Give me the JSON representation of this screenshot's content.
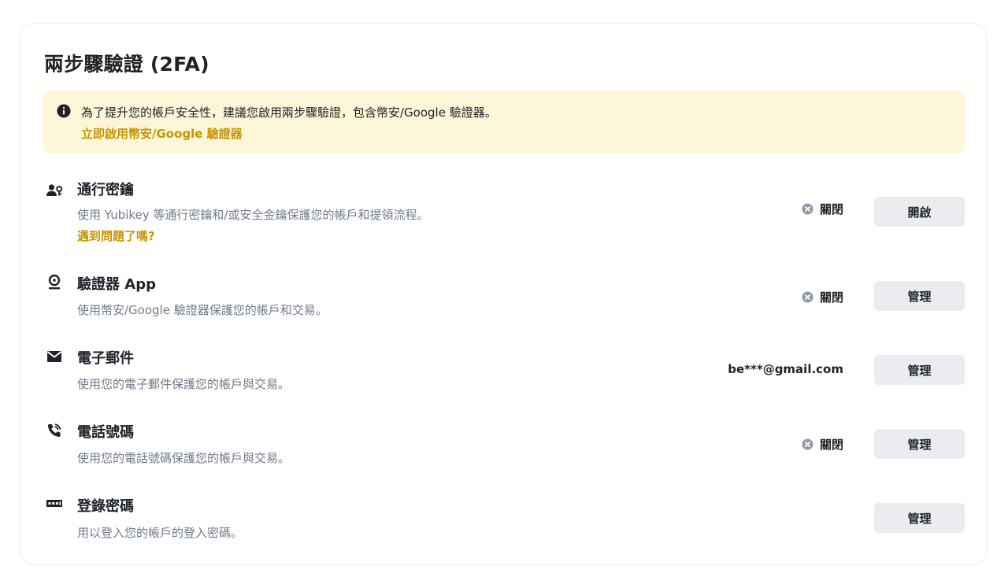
{
  "page": {
    "title": "兩步驟驗證 (2FA)"
  },
  "notice": {
    "icon": "info-icon",
    "text": "為了提升您的帳戶安全性，建議您啟用兩步驟驗證，包含幣安/Google 驗證器。",
    "link": "立即啟用幣安/Google 驗證器"
  },
  "methods": [
    {
      "icon": "passkey-icon",
      "title": "通行密鑰",
      "description": "使用 Yubikey 等通行密鑰和/或安全金鑰保護您的帳戶和提領流程。",
      "help_link": "遇到問題了嗎?",
      "status": "關閉",
      "button": "開啟"
    },
    {
      "icon": "authenticator-icon",
      "title": "驗證器 App",
      "description": "使用幣安/Google 驗證器保護您的帳戶和交易。",
      "status": "關閉",
      "button": "管理"
    },
    {
      "icon": "email-icon",
      "title": "電子郵件",
      "description": "使用您的電子郵件保護您的帳戶與交易。",
      "value": "be***@gmail.com",
      "button": "管理"
    },
    {
      "icon": "phone-icon",
      "title": "電話號碼",
      "description": "使用您的電話號碼保護您的帳戶與交易。",
      "status": "關閉",
      "button": "管理"
    },
    {
      "icon": "password-icon",
      "title": "登錄密碼",
      "description": "用以登入您的帳戶的登入密碼。",
      "button": "管理"
    }
  ],
  "colors": {
    "accent": "#c99400",
    "notice_bg": "#fef6d8",
    "button_bg": "#eaecef",
    "muted_text": "#707a8a",
    "status_icon": "#929aa5"
  }
}
